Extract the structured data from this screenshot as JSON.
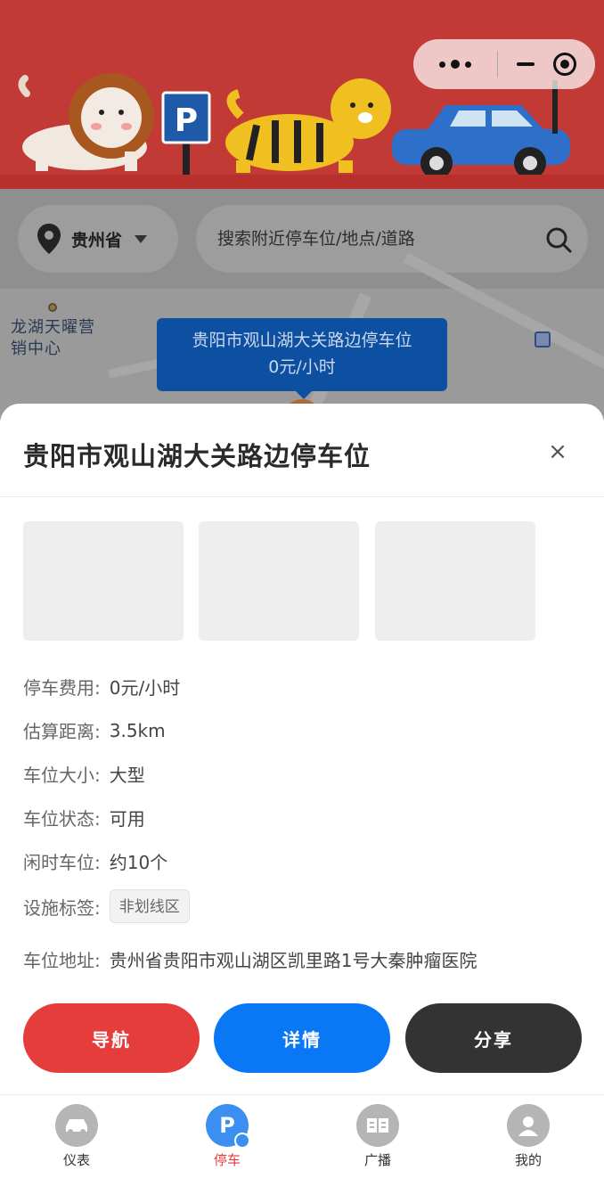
{
  "banner": {
    "parking_sign": "P"
  },
  "search": {
    "province": "贵州省",
    "placeholder": "搜索附近停车位/地点/道路"
  },
  "map": {
    "poi_label": "龙湖天曜营销中心",
    "bubble_title": "贵阳市观山湖大关路边停车位",
    "bubble_price": "0元/小时"
  },
  "sheet": {
    "title": "贵阳市观山湖大关路边停车位",
    "close": "×",
    "rows": [
      {
        "label": "停车费用:",
        "value": "0元/小时"
      },
      {
        "label": "估算距离:",
        "value": "3.5km"
      },
      {
        "label": "车位大小:",
        "value": "大型"
      },
      {
        "label": "车位状态:",
        "value": "可用"
      },
      {
        "label": "闲时车位:",
        "value": "约10个"
      }
    ],
    "tags_label": "设施标签:",
    "tag": "非划线区",
    "address_label": "车位地址:",
    "address": "贵州省贵阳市观山湖区凯里路1号大秦肿瘤医院"
  },
  "actions": {
    "navigate": "导航",
    "details": "详情",
    "share": "分享"
  },
  "tabs": [
    {
      "label": "仪表"
    },
    {
      "label": "停车"
    },
    {
      "label": "广播"
    },
    {
      "label": "我的"
    }
  ],
  "colors": {
    "navigate": "#e53c3c",
    "details": "#0a78f5",
    "share": "#333333",
    "active_tab": "#e5393b",
    "banner": "#c23a36"
  }
}
